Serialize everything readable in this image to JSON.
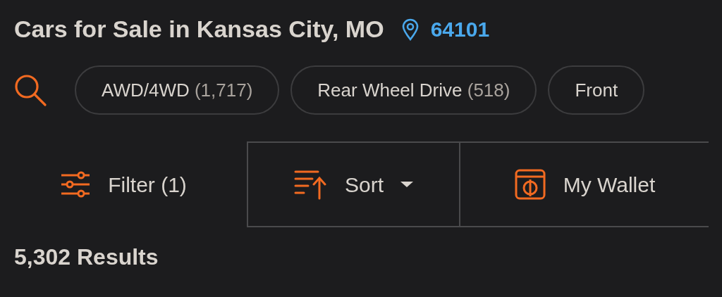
{
  "header": {
    "title": "Cars for Sale in Kansas City, MO",
    "zip": "64101"
  },
  "chips": [
    {
      "label": "AWD/4WD",
      "count": "(1,717)"
    },
    {
      "label": "Rear Wheel Drive",
      "count": "(518)"
    },
    {
      "label": "Front"
    }
  ],
  "toolbar": [
    {
      "kind": "filter",
      "label": "Filter (1)"
    },
    {
      "kind": "sort",
      "label": "Sort"
    },
    {
      "kind": "wallet",
      "label": "My Wallet"
    }
  ],
  "results": "5,302 Results"
}
